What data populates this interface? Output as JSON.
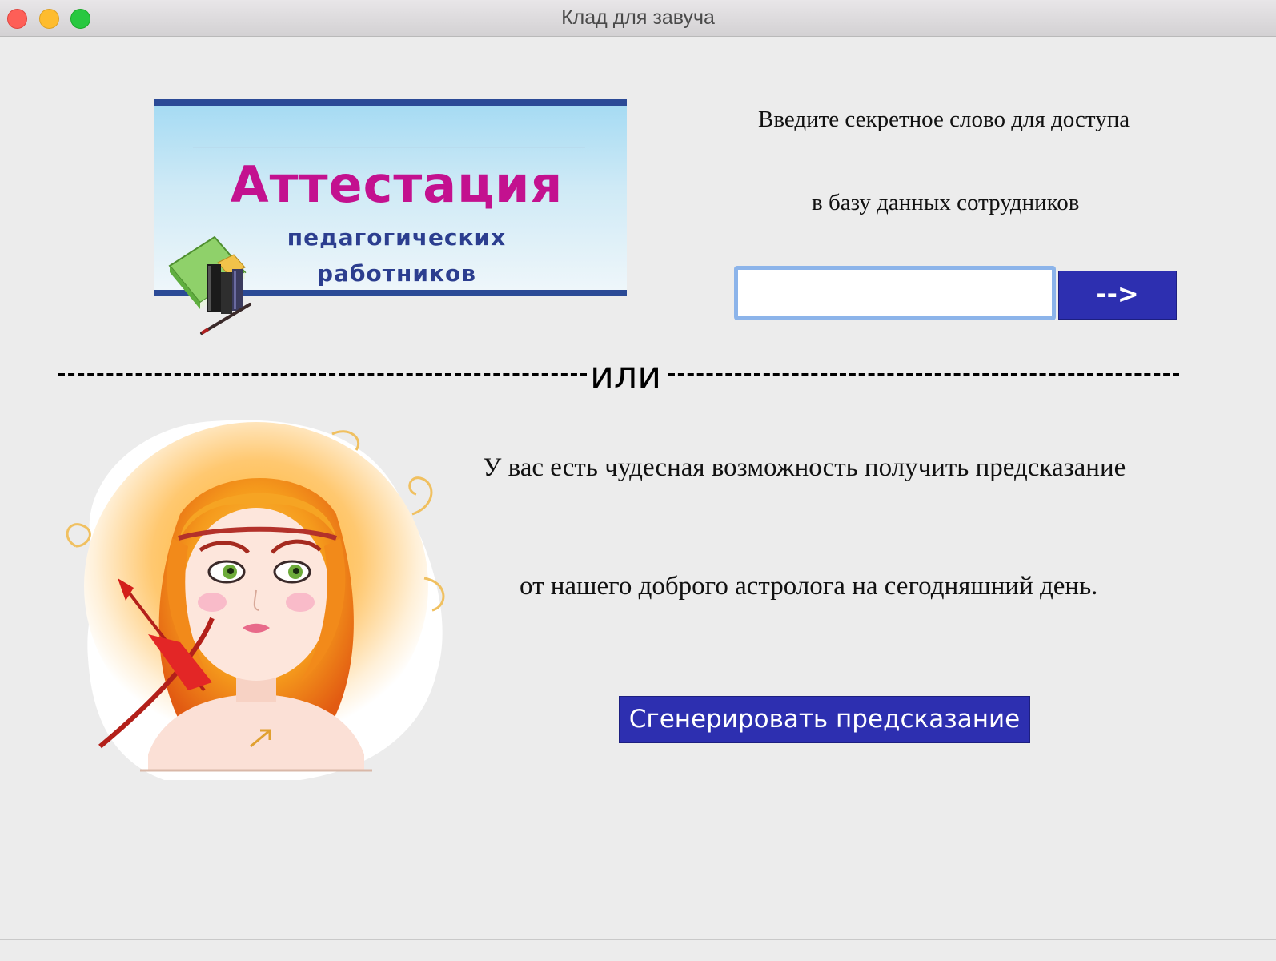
{
  "window": {
    "title": "Клад для завуча"
  },
  "banner": {
    "title": "Аттестация",
    "subtitle_line1": "педагогических",
    "subtitle_line2": "работников",
    "icon": "books-icon",
    "colors": {
      "title": "#c3118f",
      "subtitle": "#2c3e8f",
      "border": "#2b4a96"
    }
  },
  "login": {
    "prompt_line1": "Введите секретное слово для доступа",
    "prompt_line2": "в базу данных сотрудников",
    "input_value": "",
    "submit_label": "-->"
  },
  "divider": {
    "label": "или"
  },
  "horoscope": {
    "illustration": "sagittarius-girl-illustration",
    "text_line1": "У вас есть чудесная возможность получить предсказание",
    "text_line2": "от нашего доброго астролога на сегодняшний день.",
    "button_label": "Сгенерировать предсказание"
  },
  "colors": {
    "button_bg": "#2d2fb0",
    "window_bg": "#ececec",
    "input_focus": "#8cb4ea"
  }
}
